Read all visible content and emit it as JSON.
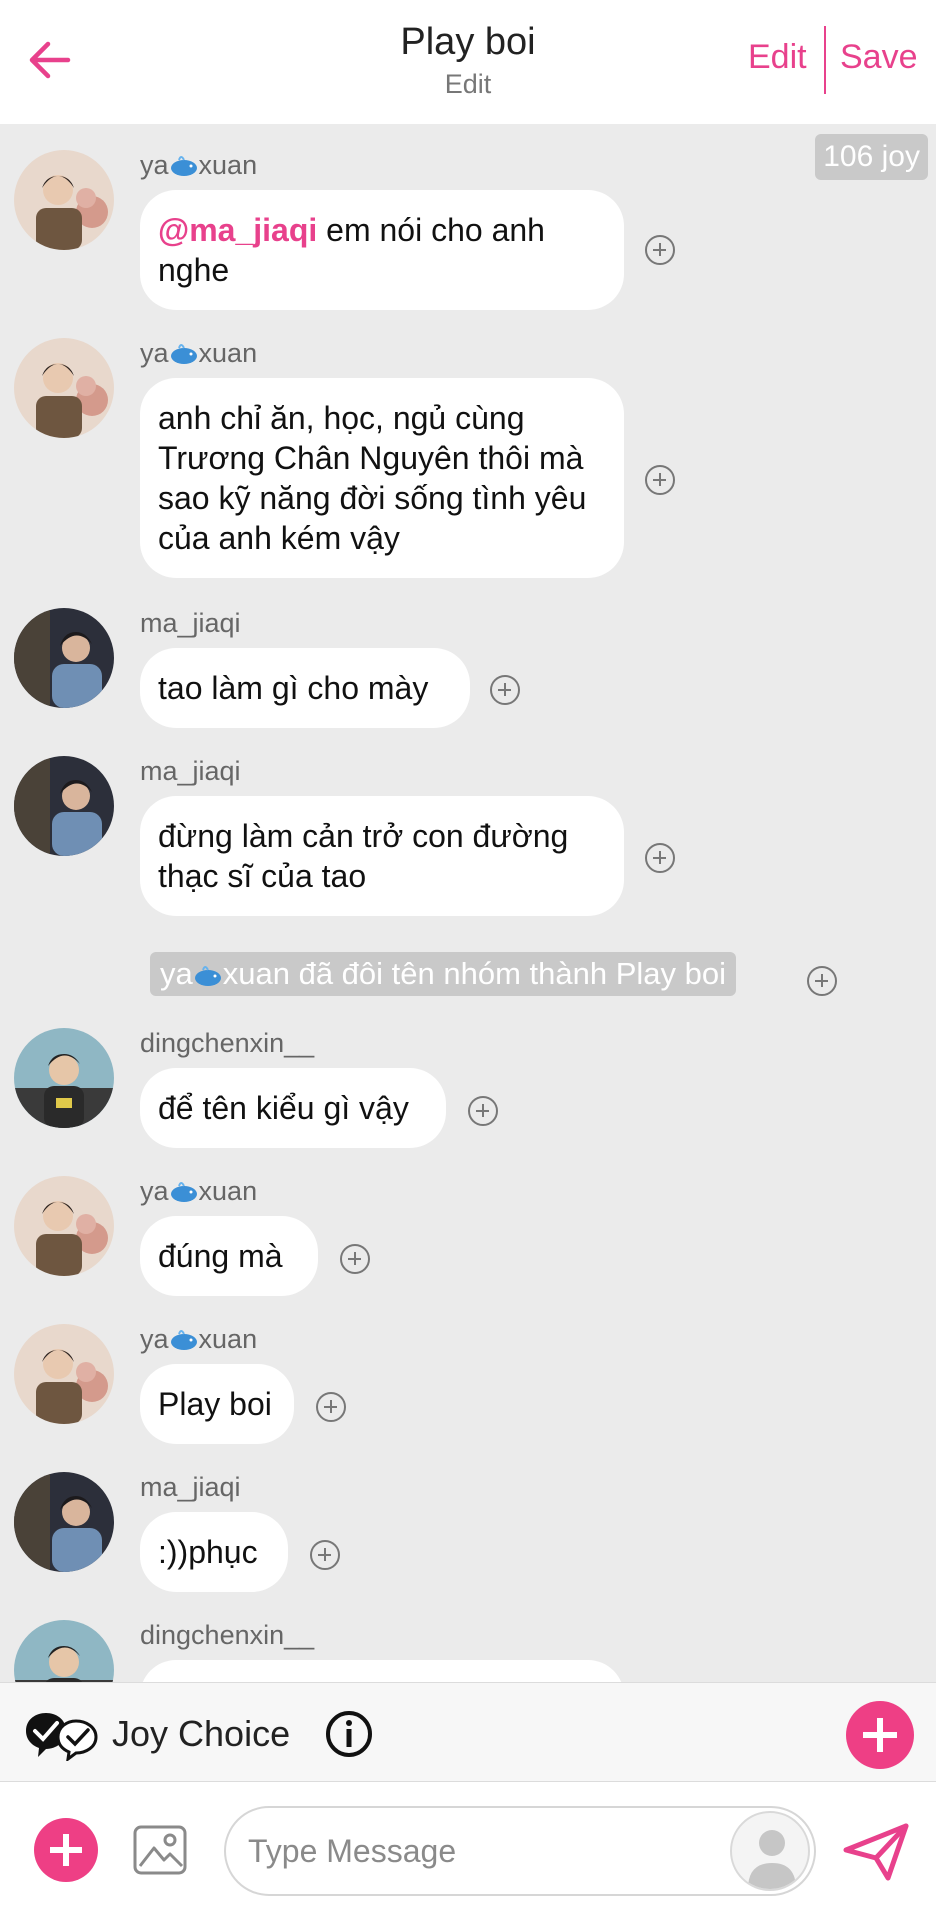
{
  "header": {
    "title": "Play boi",
    "subtitle": "Edit",
    "edit_label": "Edit",
    "save_label": "Save"
  },
  "joy_badge": "106 joy",
  "messages": [
    {
      "sender_pre": "ya",
      "sender_post": "xuan",
      "mention": "@ma_jiaqi",
      "text": " em nói cho anh nghe"
    },
    {
      "sender_pre": "ya",
      "sender_post": "xuan",
      "text": "anh chỉ ăn, học, ngủ cùng Trương Chân Nguyên thôi mà sao kỹ năng đời sống tình yêu của anh kém vậy"
    },
    {
      "sender": "ma_jiaqi",
      "text": "tao làm gì cho mày"
    },
    {
      "sender": "ma_jiaqi",
      "text": "đừng làm cản trở con đường thạc sĩ của tao"
    },
    {
      "sender": "dingchenxin__",
      "text": "để tên kiểu gì vậy"
    },
    {
      "sender_pre": "ya",
      "sender_post": "xuan",
      "text": "đúng mà"
    },
    {
      "sender_pre": "ya",
      "sender_post": "xuan",
      "text": "Play boi"
    },
    {
      "sender": "ma_jiaqi",
      "text": ":))phục"
    },
    {
      "sender": "dingchenxin__",
      "text": ""
    }
  ],
  "system_note": {
    "pre": "ya",
    "post": "xuan đã đôi tên nhóm thành Play boi"
  },
  "joy_choice": {
    "label": "Joy Choice"
  },
  "input": {
    "placeholder": "Type Message",
    "value": ""
  },
  "colors": {
    "accent": "#e8418c",
    "bubble": "#ffffff",
    "background": "#ebebeb"
  }
}
